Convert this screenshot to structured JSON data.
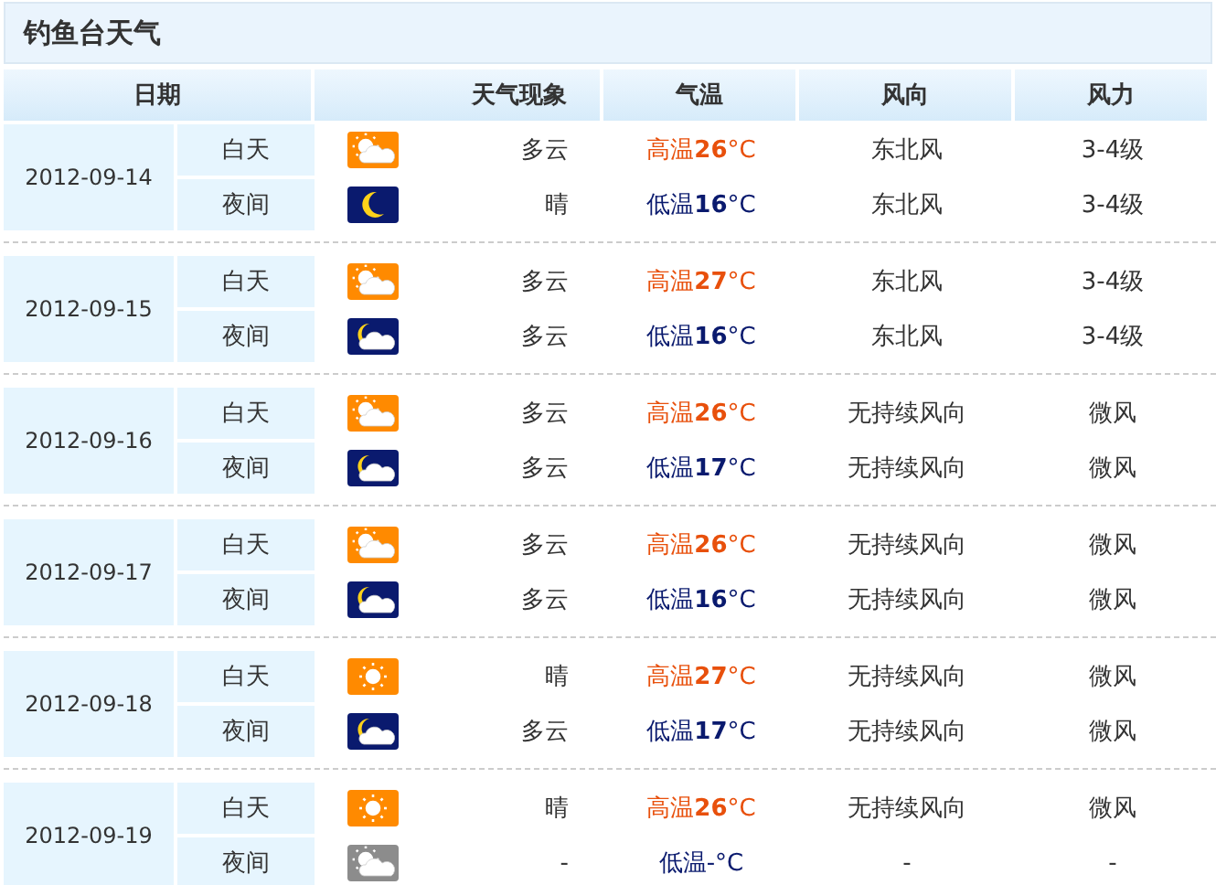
{
  "title": "钓鱼台天气",
  "columns": [
    "日期",
    "天气现象",
    "气温",
    "风向",
    "风力"
  ],
  "days": [
    {
      "date": "2012-09-14",
      "periods": [
        {
          "label": "白天",
          "icon": {
            "kind": "sun-cloud"
          },
          "weather": "多云",
          "temperature": {
            "kind": "high",
            "text": "高温**26**°C"
          },
          "wind_dir": "东北风",
          "wind_force": "3-4级"
        },
        {
          "label": "夜间",
          "icon": {
            "kind": "moon"
          },
          "weather": "晴",
          "temperature": {
            "kind": "low",
            "text": "低温**16**°C"
          },
          "wind_dir": "东北风",
          "wind_force": "3-4级"
        }
      ]
    },
    {
      "date": "2012-09-15",
      "periods": [
        {
          "label": "白天",
          "icon": {
            "kind": "sun-cloud"
          },
          "weather": "多云",
          "temperature": {
            "kind": "high",
            "text": "高温**27**°C"
          },
          "wind_dir": "东北风",
          "wind_force": "3-4级"
        },
        {
          "label": "夜间",
          "icon": {
            "kind": "moon-cloud"
          },
          "weather": "多云",
          "temperature": {
            "kind": "low",
            "text": "低温**16**°C"
          },
          "wind_dir": "东北风",
          "wind_force": "3-4级"
        }
      ]
    },
    {
      "date": "2012-09-16",
      "periods": [
        {
          "label": "白天",
          "icon": {
            "kind": "sun-cloud"
          },
          "weather": "多云",
          "temperature": {
            "kind": "high",
            "text": "高温**26**°C"
          },
          "wind_dir": "无持续风向",
          "wind_force": "微风"
        },
        {
          "label": "夜间",
          "icon": {
            "kind": "moon-cloud"
          },
          "weather": "多云",
          "temperature": {
            "kind": "low",
            "text": "低温**17**°C"
          },
          "wind_dir": "无持续风向",
          "wind_force": "微风"
        }
      ]
    },
    {
      "date": "2012-09-17",
      "periods": [
        {
          "label": "白天",
          "icon": {
            "kind": "sun-cloud"
          },
          "weather": "多云",
          "temperature": {
            "kind": "high",
            "text": "高温**26**°C"
          },
          "wind_dir": "无持续风向",
          "wind_force": "微风"
        },
        {
          "label": "夜间",
          "icon": {
            "kind": "moon-cloud"
          },
          "weather": "多云",
          "temperature": {
            "kind": "low",
            "text": "低温**16**°C"
          },
          "wind_dir": "无持续风向",
          "wind_force": "微风"
        }
      ]
    },
    {
      "date": "2012-09-18",
      "periods": [
        {
          "label": "白天",
          "icon": {
            "kind": "sun"
          },
          "weather": "晴",
          "temperature": {
            "kind": "high",
            "text": "高温**27**°C"
          },
          "wind_dir": "无持续风向",
          "wind_force": "微风"
        },
        {
          "label": "夜间",
          "icon": {
            "kind": "moon-cloud"
          },
          "weather": "多云",
          "temperature": {
            "kind": "low",
            "text": "低温**17**°C"
          },
          "wind_dir": "无持续风向",
          "wind_force": "微风"
        }
      ]
    },
    {
      "date": "2012-09-19",
      "periods": [
        {
          "label": "白天",
          "icon": {
            "kind": "sun"
          },
          "weather": "晴",
          "temperature": {
            "kind": "high",
            "text": "高温**26**°C"
          },
          "wind_dir": "无持续风向",
          "wind_force": "微风"
        },
        {
          "label": "夜间",
          "icon": {
            "kind": "no-data"
          },
          "weather": "-",
          "temperature": {
            "kind": "low",
            "text": "低温-°C"
          },
          "wind_dir": "-",
          "wind_force": "-"
        }
      ]
    }
  ]
}
